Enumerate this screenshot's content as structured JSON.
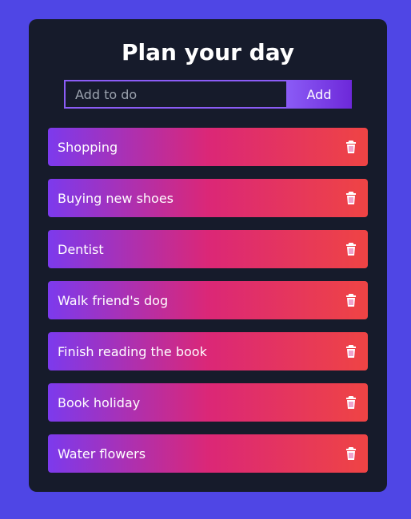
{
  "app": {
    "title": "Plan your day"
  },
  "form": {
    "input_value": "",
    "input_placeholder": "Add to do",
    "add_label": "Add"
  },
  "todos": [
    {
      "text": "Shopping",
      "icon": "trash-icon"
    },
    {
      "text": "Buying new shoes",
      "icon": "trash-icon"
    },
    {
      "text": "Dentist",
      "icon": "trash-icon"
    },
    {
      "text": "Walk friend's dog",
      "icon": "trash-icon"
    },
    {
      "text": "Finish reading the book",
      "icon": "trash-icon"
    },
    {
      "text": "Book holiday",
      "icon": "trash-icon"
    },
    {
      "text": "Water flowers",
      "icon": "trash-icon"
    }
  ],
  "colors": {
    "page_background": "#4f46e5",
    "card_background": "#161b2b",
    "accent": "#8b5cf6",
    "item_gradient_start": "#7c3aed",
    "item_gradient_mid": "#db2777",
    "item_gradient_end": "#ef4444"
  }
}
